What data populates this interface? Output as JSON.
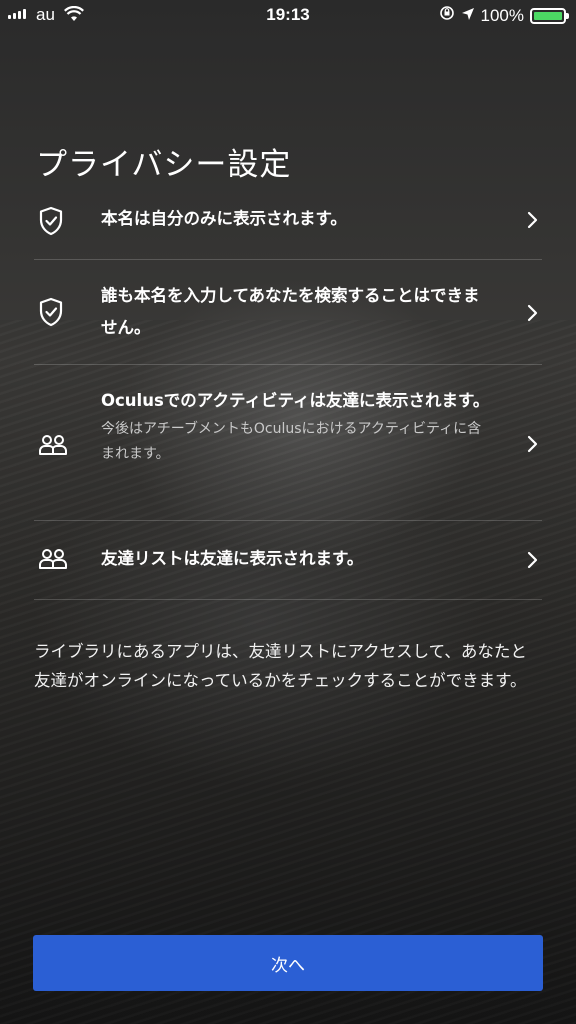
{
  "status_bar": {
    "carrier": "au",
    "time": "19:13",
    "battery_percent": "100%",
    "battery_level": 1.0,
    "battery_color": "#4cd964"
  },
  "page": {
    "title": "プライバシー設定"
  },
  "settings": [
    {
      "icon": "shield-check-icon",
      "main": "本名は自分のみに表示されます。",
      "sub": ""
    },
    {
      "icon": "shield-check-icon",
      "main": "誰も本名を入力してあなたを検索することはできません。",
      "sub": ""
    },
    {
      "icon": "people-icon",
      "main": "Oculusでのアクティビティは友達に表示されます。",
      "sub": "今後はアチーブメントもOculusにおけるアクティビティに含まれます。"
    },
    {
      "icon": "people-icon",
      "main": "友達リストは友達に表示されます。",
      "sub": ""
    }
  ],
  "note": "ライブラリにあるアプリは、友達リストにアクセスして、あなたと友達がオンラインになっているかをチェックすることができます。",
  "buttons": {
    "next_label": "次へ",
    "next_color": "#2b5fd4"
  }
}
